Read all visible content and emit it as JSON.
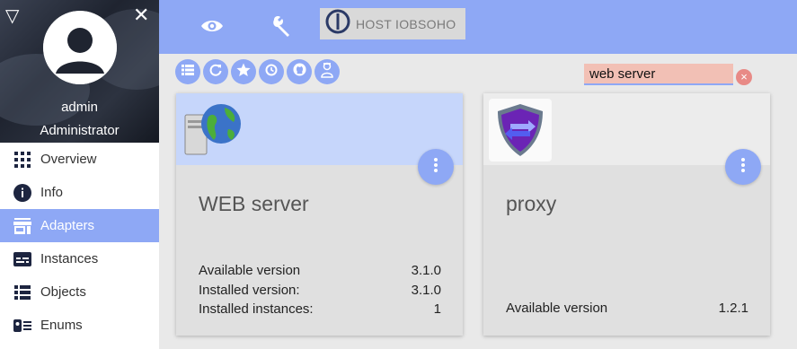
{
  "sidebar": {
    "user_name": "admin",
    "user_role": "Administrator",
    "items": [
      {
        "label": "Overview",
        "icon": "grid-icon"
      },
      {
        "label": "Info",
        "icon": "info-icon"
      },
      {
        "label": "Adapters",
        "icon": "store-icon",
        "active": true
      },
      {
        "label": "Instances",
        "icon": "instances-icon"
      },
      {
        "label": "Objects",
        "icon": "list-icon"
      },
      {
        "label": "Enums",
        "icon": "enums-icon"
      }
    ]
  },
  "topbar": {
    "host_label": "HOST IOBSOHO"
  },
  "search": {
    "value": "web server",
    "clear_label": "×"
  },
  "cards": [
    {
      "title": "WEB server",
      "rows": [
        {
          "label": "Available version",
          "value": "3.1.0"
        },
        {
          "label": "Installed version:",
          "value": "3.1.0"
        },
        {
          "label": "Installed instances:",
          "value": "1"
        }
      ]
    },
    {
      "title": "proxy",
      "rows": [
        {
          "label": "Available version",
          "value": "1.2.1"
        }
      ]
    }
  ],
  "colors": {
    "accent": "#8ea8f5",
    "search_bg": "#f2c0b5",
    "card_bg": "#e0e0e0",
    "card_top_active": "#c6d6fb"
  }
}
